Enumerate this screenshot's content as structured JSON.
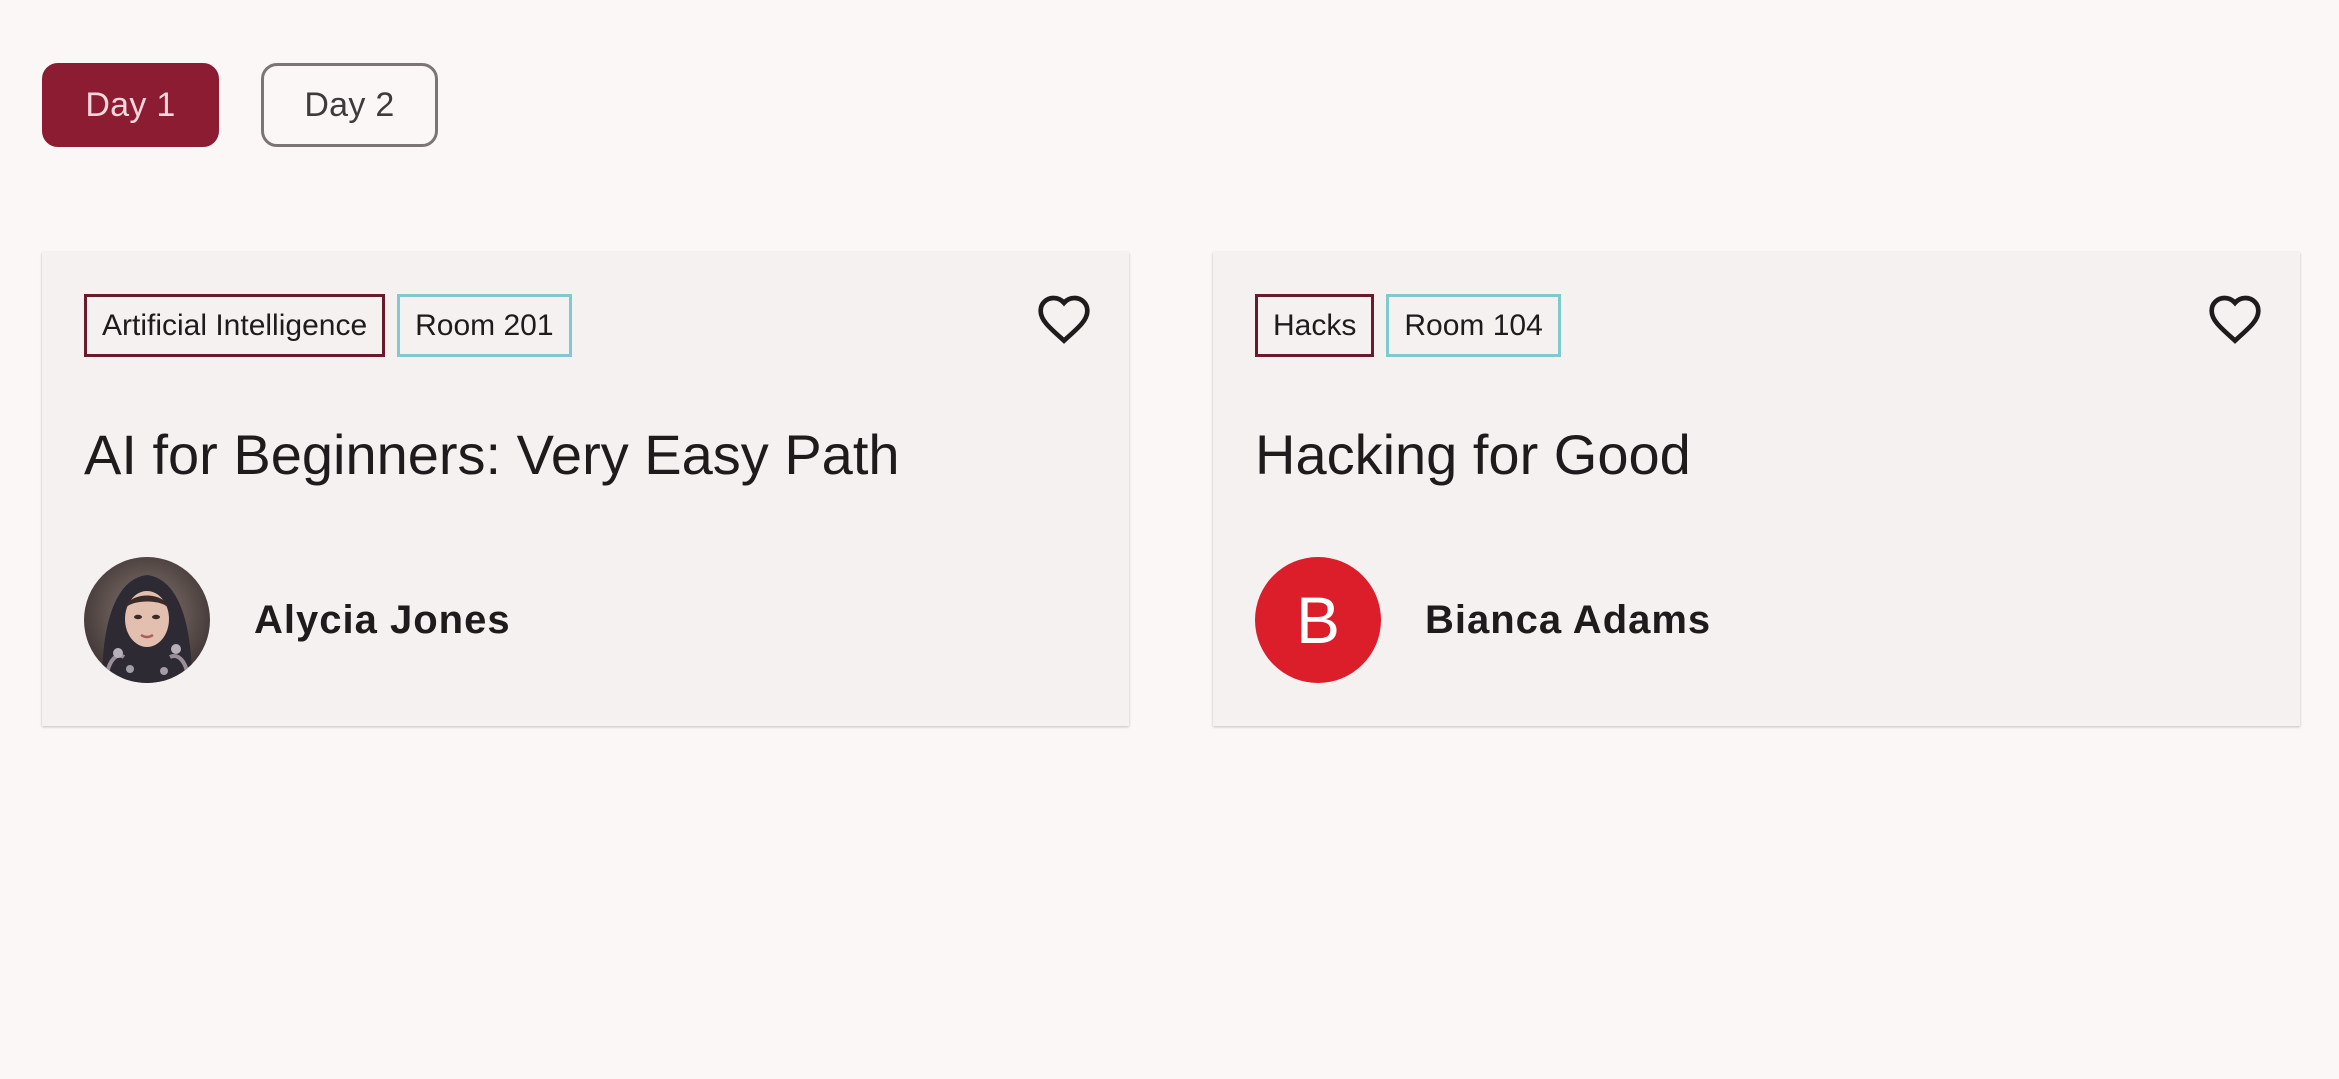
{
  "day_tabs": [
    {
      "label": "Day 1",
      "selected": true
    },
    {
      "label": "Day 2",
      "selected": false
    }
  ],
  "sessions": [
    {
      "topic_tag": "Artificial Intelligence",
      "room_tag": "Room 201",
      "title": "AI for Beginners: Very Easy Path",
      "speaker": {
        "name": "Alycia Jones",
        "avatar": "photo"
      },
      "favorite_icon": "heart-outline-icon"
    },
    {
      "topic_tag": "Hacks",
      "room_tag": "Room 104",
      "title": "Hacking for Good",
      "speaker": {
        "name": "Bianca Adams",
        "avatar_letter": "B",
        "avatar_color": "#dc1d2a"
      },
      "favorite_icon": "heart-outline-icon"
    }
  ],
  "colors": {
    "accent": "#8b1c31",
    "topic_border": "#6a1b2b",
    "room_border": "#7fc9cf",
    "background": "#fbf7f6",
    "card": "#f5f1f0"
  }
}
